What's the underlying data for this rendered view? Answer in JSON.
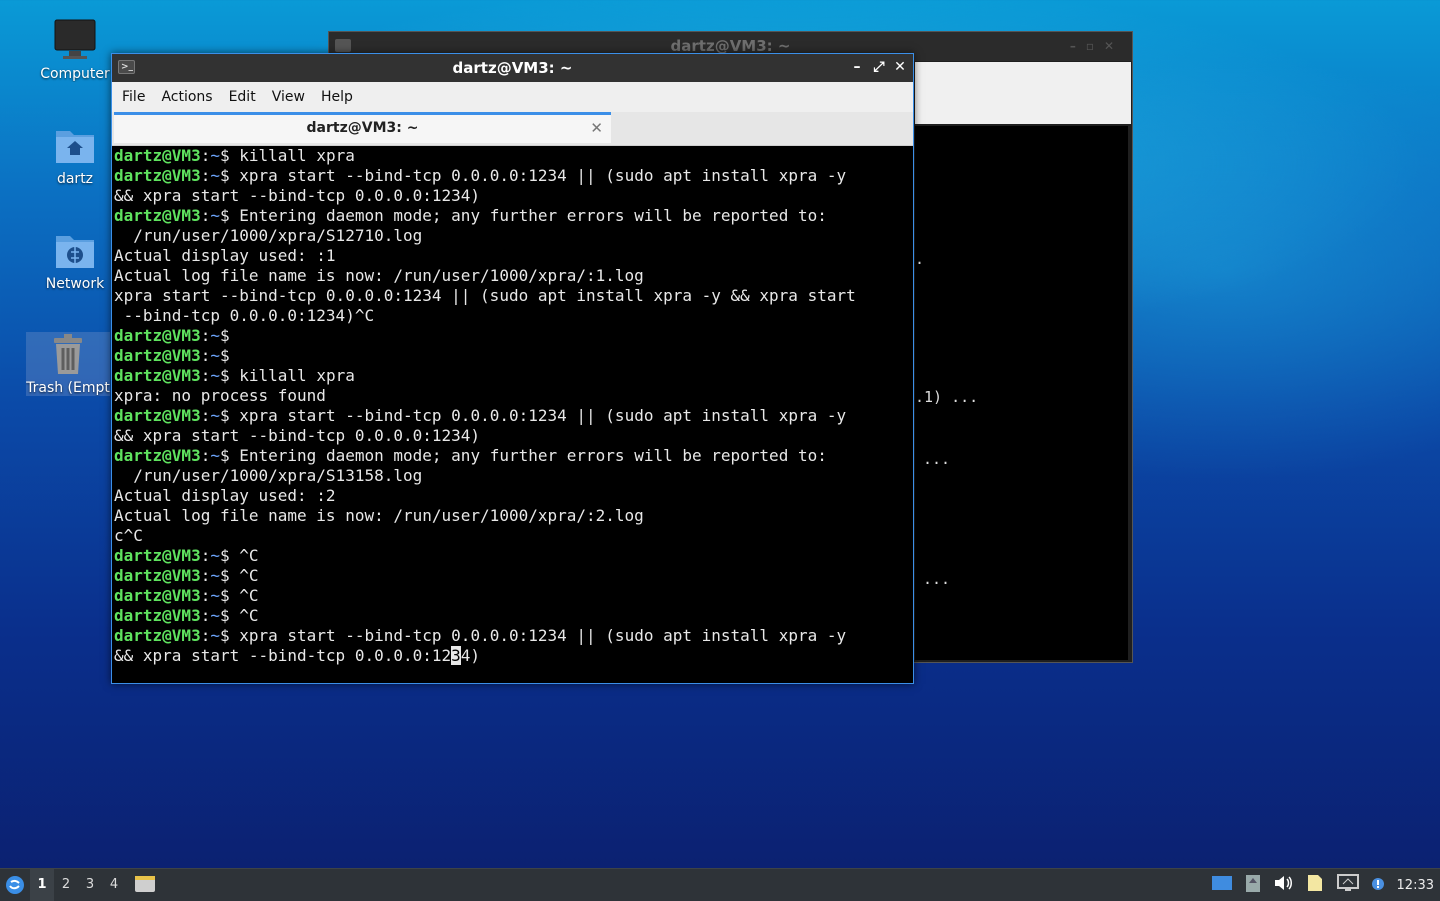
{
  "desktop": {
    "icons": [
      {
        "label": "Computer",
        "icon": "monitor-icon"
      },
      {
        "label": "dartz",
        "icon": "home-folder-icon"
      },
      {
        "label": "Network",
        "icon": "network-folder-icon"
      },
      {
        "label": "Trash (Empt",
        "icon": "trash-icon"
      }
    ]
  },
  "back_window": {
    "title": "dartz@VM3: ~",
    "visible_fragments": [
      ".",
      ".1) ...",
      "...",
      "..."
    ]
  },
  "window": {
    "title": "dartz@VM3: ~",
    "minimize": "–",
    "maximize": "⤢",
    "close": "✕",
    "menu": [
      "File",
      "Actions",
      "Edit",
      "View",
      "Help"
    ],
    "tab_title": "dartz@VM3: ~",
    "tab_close": "✕"
  },
  "terminal": {
    "user": "dartz@VM3",
    "path": "~",
    "lines": [
      {
        "prompt": true,
        "text": "$ killall xpra"
      },
      {
        "prompt": true,
        "text": "$ xpra start --bind-tcp 0.0.0.0:1234 || (sudo apt install xpra -y"
      },
      {
        "prompt": false,
        "text": "&& xpra start --bind-tcp 0.0.0.0:1234)"
      },
      {
        "prompt": true,
        "text": "$ Entering daemon mode; any further errors will be reported to:"
      },
      {
        "prompt": false,
        "text": "  /run/user/1000/xpra/S12710.log"
      },
      {
        "prompt": false,
        "text": "Actual display used: :1"
      },
      {
        "prompt": false,
        "text": "Actual log file name is now: /run/user/1000/xpra/:1.log"
      },
      {
        "prompt": false,
        "text": "xpra start --bind-tcp 0.0.0.0:1234 || (sudo apt install xpra -y && xpra start"
      },
      {
        "prompt": false,
        "text": " --bind-tcp 0.0.0.0:1234)^C"
      },
      {
        "prompt": true,
        "text": "$"
      },
      {
        "prompt": true,
        "text": "$"
      },
      {
        "prompt": true,
        "text": "$ killall xpra"
      },
      {
        "prompt": false,
        "text": "xpra: no process found"
      },
      {
        "prompt": true,
        "text": "$ xpra start --bind-tcp 0.0.0.0:1234 || (sudo apt install xpra -y"
      },
      {
        "prompt": false,
        "text": "&& xpra start --bind-tcp 0.0.0.0:1234)"
      },
      {
        "prompt": true,
        "text": "$ Entering daemon mode; any further errors will be reported to:"
      },
      {
        "prompt": false,
        "text": "  /run/user/1000/xpra/S13158.log"
      },
      {
        "prompt": false,
        "text": "Actual display used: :2"
      },
      {
        "prompt": false,
        "text": "Actual log file name is now: /run/user/1000/xpra/:2.log"
      },
      {
        "prompt": false,
        "text": "c^C"
      },
      {
        "prompt": true,
        "text": "$ ^C"
      },
      {
        "prompt": true,
        "text": "$ ^C"
      },
      {
        "prompt": true,
        "text": "$ ^C"
      },
      {
        "prompt": true,
        "text": "$ ^C"
      },
      {
        "prompt": true,
        "text": "$ xpra start --bind-tcp 0.0.0.0:1234 || (sudo apt install xpra -y"
      }
    ],
    "last_line_before_cursor": "&& xpra start --bind-tcp 0.0.0.0:12",
    "cursor_char": "3",
    "last_line_after_cursor": "4)"
  },
  "taskbar": {
    "workspaces": [
      "1",
      "2",
      "3",
      "4"
    ],
    "active_workspace": "1",
    "clock": "12:33",
    "tray_icons": [
      "show-desktop-icon",
      "clipboard-icon",
      "volume-icon",
      "notes-icon",
      "network-icon",
      "update-notification-icon"
    ]
  },
  "colors": {
    "prompt_user": "#5fe35f",
    "prompt_path": "#6ea7ff",
    "accent": "#3b8fe8"
  }
}
